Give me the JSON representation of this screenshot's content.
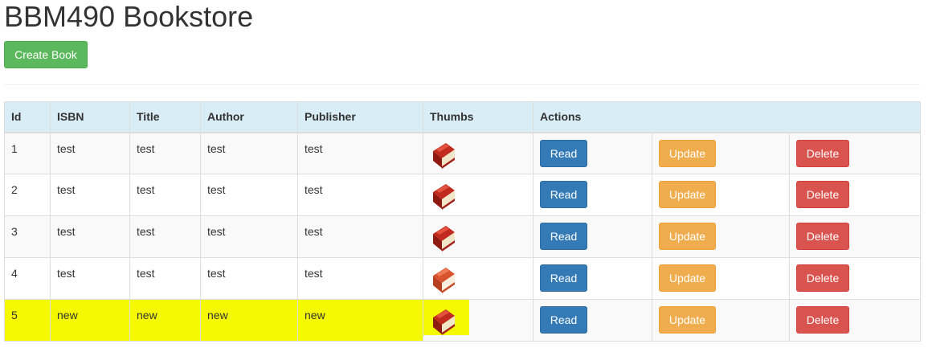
{
  "page": {
    "title": "BBM490 Bookstore",
    "create_label": "Create Book"
  },
  "table": {
    "headers": [
      "Id",
      "ISBN",
      "Title",
      "Author",
      "Publisher",
      "Thumbs",
      "Actions"
    ],
    "rows": [
      {
        "id": "1",
        "isbn": "test",
        "title": "test",
        "author": "test",
        "publisher": "test",
        "thumb_icon": "book-icon",
        "highlighted": false
      },
      {
        "id": "2",
        "isbn": "test",
        "title": "test",
        "author": "test",
        "publisher": "test",
        "thumb_icon": "book-icon",
        "highlighted": false
      },
      {
        "id": "3",
        "isbn": "test",
        "title": "test",
        "author": "test",
        "publisher": "test",
        "thumb_icon": "book-icon",
        "highlighted": false
      },
      {
        "id": "4",
        "isbn": "test",
        "title": "test",
        "author": "test",
        "publisher": "test",
        "thumb_icon": "book-icon",
        "highlighted": false
      },
      {
        "id": "5",
        "isbn": "new",
        "title": "new",
        "author": "new",
        "publisher": "new",
        "thumb_icon": "book-icon",
        "highlighted": true
      }
    ],
    "actions": {
      "read_label": "Read",
      "update_label": "Update",
      "delete_label": "Delete"
    }
  },
  "colors": {
    "create_button": "#5cb85c",
    "read_button": "#337ab7",
    "update_button": "#f0ad4e",
    "delete_button": "#d9534f",
    "header_bg": "#d9edf7",
    "highlight": "#f5f900"
  }
}
